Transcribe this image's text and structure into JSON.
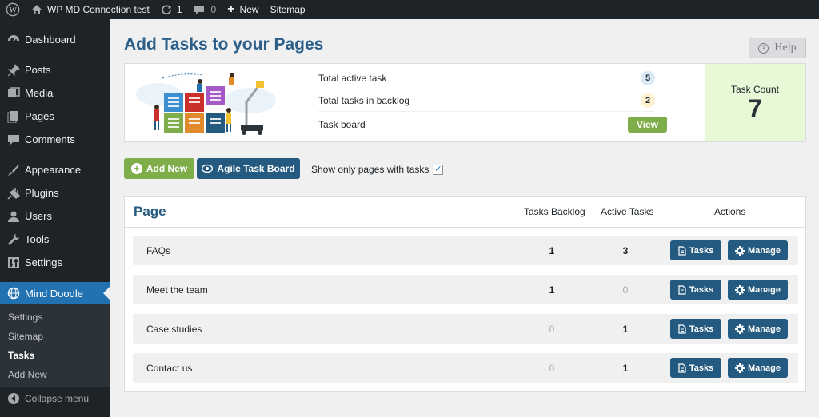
{
  "adminbar": {
    "site_name": "WP MD Connection test",
    "updates_count": "1",
    "comments_count": "0",
    "new_label": "New",
    "sitemap_label": "Sitemap"
  },
  "sidebar": {
    "items": [
      {
        "label": "Dashboard",
        "icon": "dashboard-icon"
      },
      {
        "label": "Posts",
        "icon": "pin-icon"
      },
      {
        "label": "Media",
        "icon": "media-icon"
      },
      {
        "label": "Pages",
        "icon": "pages-icon"
      },
      {
        "label": "Comments",
        "icon": "comment-icon"
      },
      {
        "label": "Appearance",
        "icon": "brush-icon"
      },
      {
        "label": "Plugins",
        "icon": "plug-icon"
      },
      {
        "label": "Users",
        "icon": "user-icon"
      },
      {
        "label": "Tools",
        "icon": "wrench-icon"
      },
      {
        "label": "Settings",
        "icon": "settings-icon"
      }
    ],
    "active": {
      "label": "Mind Doodle",
      "icon": "globe-icon"
    },
    "submenu": [
      "Settings",
      "Sitemap",
      "Tasks",
      "Add New"
    ],
    "current_sub": "Tasks",
    "collapse_label": "Collapse menu"
  },
  "header": {
    "title": "Add Tasks to your Pages",
    "help_label": "Help"
  },
  "summary": {
    "total_active_label": "Total active task",
    "total_active_value": "5",
    "backlog_label": "Total tasks in backlog",
    "backlog_value": "2",
    "board_label": "Task board",
    "view_label": "View",
    "count_label": "Task Count",
    "count_value": "7"
  },
  "toolbar": {
    "add_new_label": "Add New",
    "board_label": "Agile Task Board",
    "show_only_label": "Show only pages with tasks",
    "show_only_checked": true
  },
  "table": {
    "headers": {
      "page": "Page",
      "backlog": "Tasks Backlog",
      "active": "Active Tasks",
      "actions": "Actions"
    },
    "tasks_btn": "Tasks",
    "manage_btn": "Manage",
    "rows": [
      {
        "name": "FAQs",
        "backlog": "1",
        "active": "3"
      },
      {
        "name": "Meet the team",
        "backlog": "1",
        "active": "0"
      },
      {
        "name": "Case studies",
        "backlog": "0",
        "active": "1"
      },
      {
        "name": "Contact us",
        "backlog": "0",
        "active": "1"
      }
    ]
  },
  "colors": {
    "admin_dark": "#1d2327",
    "accent_blue": "#2271b1",
    "navy_button": "#245a7f",
    "green_button": "#7fad4a",
    "count_bg": "#e8f9d8"
  }
}
